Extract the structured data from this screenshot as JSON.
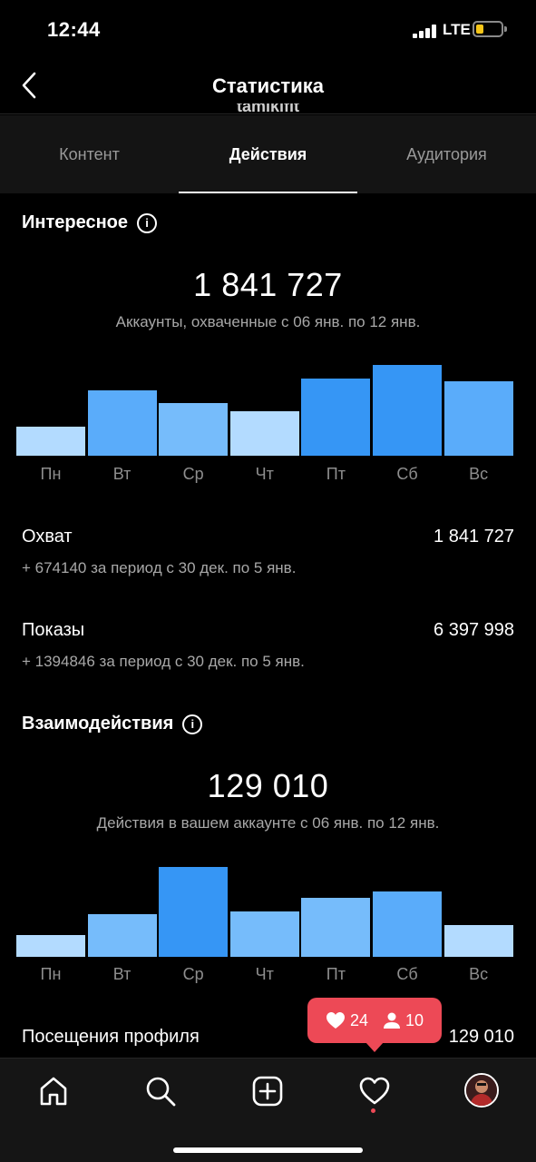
{
  "status_bar": {
    "time": "12:44",
    "network": "LTE"
  },
  "header": {
    "title": "Статистика",
    "username_peek": "tamikifit"
  },
  "tabs": [
    {
      "label": "Контент",
      "active": false
    },
    {
      "label": "Действия",
      "active": true
    },
    {
      "label": "Аудитория",
      "active": false
    }
  ],
  "discovery": {
    "title": "Интересное",
    "total": "1 841 727",
    "caption": "Аккаунты, охваченные с 06 янв. по 12 янв.",
    "chart_data": {
      "type": "bar",
      "categories": [
        "Пн",
        "Вт",
        "Ср",
        "Чт",
        "Пт",
        "Сб",
        "Вс"
      ],
      "values": [
        32,
        71,
        57,
        49,
        84,
        99,
        81
      ],
      "colors": [
        "#b3dbff",
        "#5aacfa",
        "#76bcfb",
        "#b3dbff",
        "#3696f5",
        "#3696f5",
        "#5aacfa"
      ]
    },
    "metrics": [
      {
        "label": "Охват",
        "value": "1 841 727",
        "sub": "+ 674140 за период с 30 дек. по 5 янв."
      },
      {
        "label": "Показы",
        "value": "6 397 998",
        "sub": "+ 1394846 за период с 30 дек. по 5 янв."
      }
    ]
  },
  "interactions": {
    "title": "Взаимодействия",
    "total": "129 010",
    "caption": "Действия в вашем аккаунте с 06 янв. по 12 янв.",
    "chart_data": {
      "type": "bar",
      "categories": [
        "Пн",
        "Вт",
        "Ср",
        "Чт",
        "Пт",
        "Сб",
        "Вс"
      ],
      "values": [
        24,
        47,
        100,
        51,
        66,
        73,
        35
      ],
      "colors": [
        "#b3dbff",
        "#76bcfb",
        "#3696f5",
        "#76bcfb",
        "#76bcfb",
        "#5aacfa",
        "#b3dbff"
      ]
    },
    "metrics": [
      {
        "label": "Посещения профиля",
        "value": "129 010"
      }
    ]
  },
  "notification": {
    "likes": "24",
    "follows": "10"
  },
  "nav": {
    "items": [
      {
        "icon": "home-icon"
      },
      {
        "icon": "search-icon"
      },
      {
        "icon": "add-post-icon"
      },
      {
        "icon": "activity-heart-icon"
      },
      {
        "icon": "profile-avatar"
      }
    ]
  }
}
